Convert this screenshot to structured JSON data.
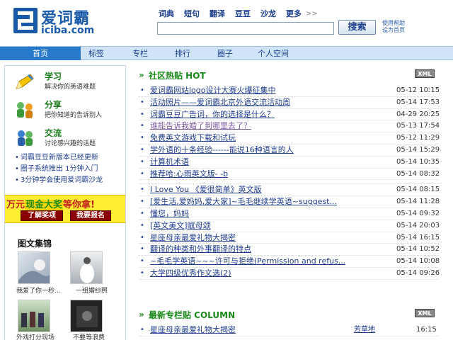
{
  "logo": {
    "text": "爱词霸",
    "domain": "iciba.com"
  },
  "topnav": {
    "items": [
      "词典",
      "短句",
      "翻译",
      "豆豆",
      "沙龙",
      "更多"
    ],
    "more_arrow": ">>"
  },
  "search": {
    "button": "搜索",
    "input_value": ""
  },
  "help": {
    "line1": "使用帮助",
    "line2": "设为首页"
  },
  "mainnav": {
    "tabs": [
      "首页",
      "标签",
      "专栏",
      "排行",
      "圈子",
      "个人空间"
    ],
    "active": 0
  },
  "sidebar": {
    "features": [
      {
        "title": "学习",
        "desc": "解决你的英语难题"
      },
      {
        "title": "分享",
        "desc": "把你知道的告诉别人"
      },
      {
        "title": "交流",
        "desc": "讨论感兴趣的话题"
      }
    ],
    "links": [
      "词霸豆豆新版本已经更新",
      "圈子系统推出 1分钟入门",
      "3分钟学会使用爱词霸沙龙"
    ],
    "promo": {
      "text_before": "万元",
      "highlight": "现金大奖",
      "text_after": "等你拿!",
      "btn1": "了解奖项",
      "btn2": "我要报名"
    },
    "gallery": {
      "title": "图文集锦",
      "captions": [
        "我爱了你一秒...",
        "一组婚纱照",
        "外戏打分现场",
        "不要等浪费"
      ]
    }
  },
  "hot": {
    "title": "社区热贴  HOT",
    "arrow": "»",
    "xml": "XML",
    "posts": [
      {
        "title": "爱词霸网站logo设计大赛火爆征集中",
        "date": "05-12 10:15",
        "visited": false
      },
      {
        "title": "活动照片——爱词霸北京外语交流活动周",
        "date": "05-14 17:53",
        "visited": false
      },
      {
        "title": "词霸豆豆广告词，你的选择是什么？",
        "date": "04-29 20:25",
        "visited": false
      },
      {
        "title": "谁能告诉我婚了到哪里去了？",
        "date": "05-13 17:54",
        "visited": true
      },
      {
        "title": "免费英文游戏下载和试玩",
        "date": "05-12 11:29",
        "visited": false
      },
      {
        "title": "学外语的十条经验------能说16种语言的人",
        "date": "05-14 15:29",
        "visited": false
      },
      {
        "title": "计算机术语",
        "date": "05-14 10:35",
        "visited": false
      },
      {
        "title": "推荐哈:心雨英文版- -b",
        "date": "05-14 08:32",
        "visited": false
      },
      {
        "title": "I Love You 《爱很简单》英文版",
        "date": "05-14 08:15",
        "visited": false
      },
      {
        "title": "[爱生活,爱妈妈,爱大家]~毛毛继续学英语~suggest...",
        "date": "05-14 11:28",
        "visited": false
      },
      {
        "title": "懂您，妈妈",
        "date": "05-14 09:32",
        "visited": false
      },
      {
        "title": "[英文美文]赋母颂",
        "date": "05-14 20:03",
        "visited": false
      },
      {
        "title": "星座母亲最爱礼物大揭密",
        "date": "05-14 16:15",
        "visited": false
      },
      {
        "title": "翻译的种类和外事翻译的特点",
        "date": "05-14 10:52",
        "visited": false
      },
      {
        "title": "~毛毛学英语~~~许可与拒绝(Permission and refus...",
        "date": "05-14 10:08",
        "visited": false
      },
      {
        "title": "大学四级优秀作文选(2)",
        "date": "05-14 09:26",
        "visited": false
      }
    ]
  },
  "column": {
    "title": "最新专栏贴  COLUMN",
    "arrow": "»",
    "xml": "XML",
    "posts": [
      {
        "title": "星座母亲最爱礼物大揭密",
        "author": "芳草地",
        "date": "16:15"
      }
    ]
  }
}
